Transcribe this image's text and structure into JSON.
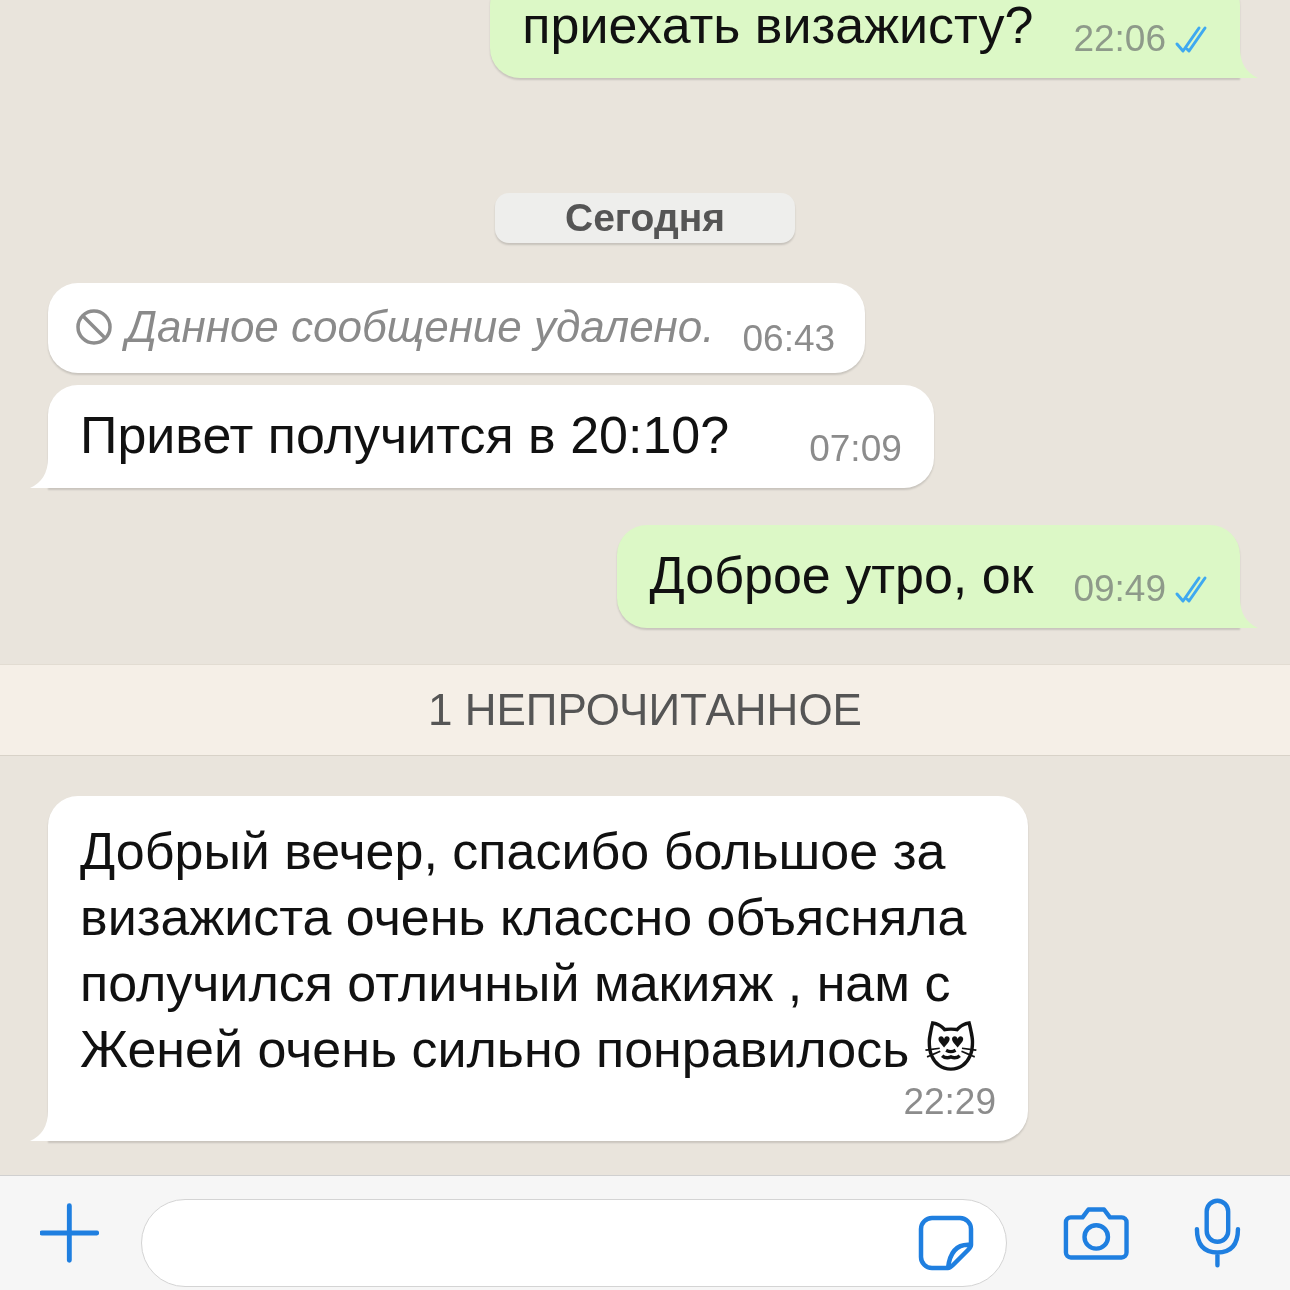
{
  "messages": [
    {
      "kind": "outgoing",
      "text": "приехать визажисту?",
      "time": "22:06",
      "read": true,
      "tail": true
    },
    {
      "kind": "date",
      "text": "Сегодня"
    },
    {
      "kind": "deleted",
      "text": "Данное сообщение удалено.",
      "time": "06:43",
      "tail": false
    },
    {
      "kind": "incoming",
      "text": "Привет получится в 20:10?",
      "time": "07:09",
      "tail": true
    },
    {
      "kind": "outgoing",
      "text": "Доброе утро, ок",
      "time": "09:49",
      "read": true,
      "tail": true
    },
    {
      "kind": "unread",
      "text": "1 НЕПРОЧИТАННОЕ"
    },
    {
      "kind": "incoming",
      "text": "Добрый вечер, спасибо большое за визажиста очень классно объясняла получился отличный макияж , нам с Женей очень сильно понравилось 😻",
      "time": "22:29",
      "tail": true
    }
  ]
}
